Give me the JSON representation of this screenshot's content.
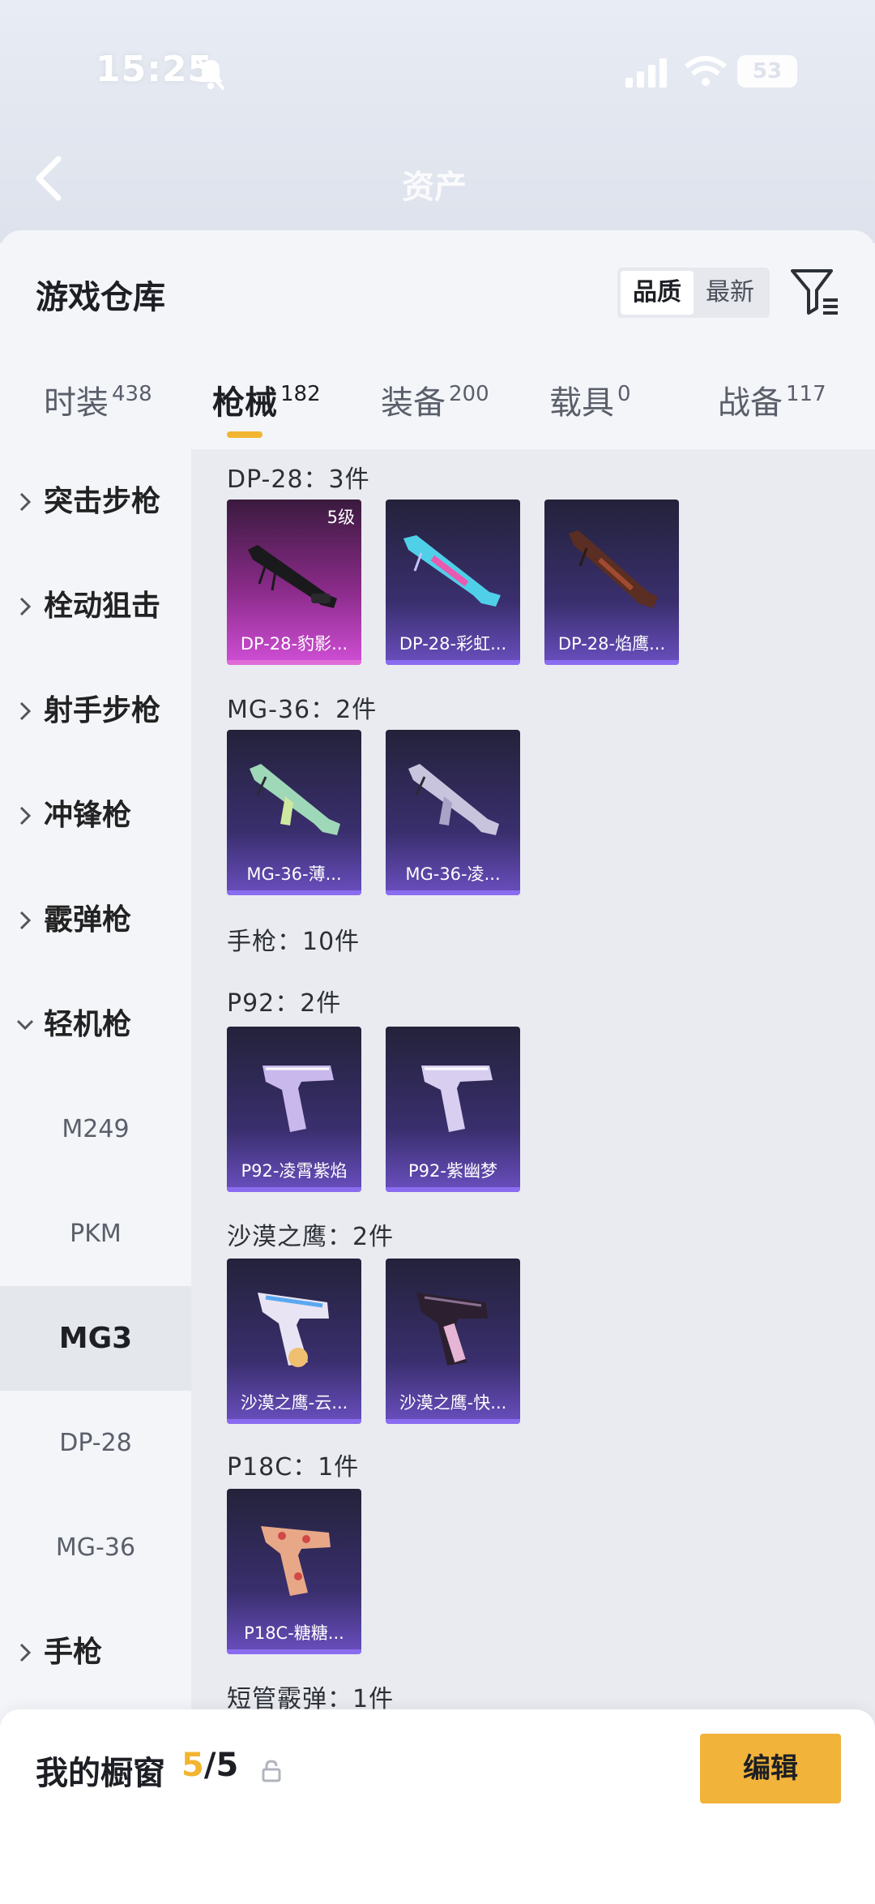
{
  "status_bar": {
    "time": "15:25",
    "battery": "53"
  },
  "header": {
    "title": "资产"
  },
  "page": {
    "title": "游戏仓库"
  },
  "sort": {
    "quality": "品质",
    "newest": "最新"
  },
  "tabs": [
    {
      "label": "时装",
      "count": "438"
    },
    {
      "label": "枪械",
      "count": "182"
    },
    {
      "label": "装备",
      "count": "200"
    },
    {
      "label": "载具",
      "count": "0"
    },
    {
      "label": "战备",
      "count": "117"
    }
  ],
  "sidebar": {
    "items": [
      {
        "label": "突击步枪"
      },
      {
        "label": "栓动狙击"
      },
      {
        "label": "射手步枪"
      },
      {
        "label": "冲锋枪"
      },
      {
        "label": "霰弹枪"
      },
      {
        "label": "轻机枪"
      },
      {
        "label": "M249"
      },
      {
        "label": "PKM"
      },
      {
        "label": "MG3"
      },
      {
        "label": "DP-28"
      },
      {
        "label": "MG-36"
      },
      {
        "label": "手枪"
      }
    ]
  },
  "groups": {
    "dp28": {
      "title": "DP-28：3件",
      "items": [
        "DP-28-豹影...",
        "DP-28-彩虹...",
        "DP-28-焰鹰..."
      ],
      "level": "5级"
    },
    "mg36": {
      "title": "MG-36：2件",
      "items": [
        "MG-36-薄...",
        "MG-36-凌..."
      ]
    },
    "pistol": {
      "title": "手枪：10件"
    },
    "p92": {
      "title": "P92：2件",
      "items": [
        "P92-凌霄紫焰",
        "P92-紫幽梦"
      ]
    },
    "deagle": {
      "title": "沙漠之鹰：2件",
      "items": [
        "沙漠之鹰-云...",
        "沙漠之鹰-快..."
      ]
    },
    "p18c": {
      "title": "P18C：1件",
      "items": [
        "P18C-糖糖..."
      ]
    },
    "sawed": {
      "title": "短管霰弹：1件"
    }
  },
  "showcase": {
    "label": "我的橱窗",
    "current": "5",
    "total": "/5",
    "edit": "编辑"
  },
  "colors": {
    "accent": "#f2b531",
    "card_purple": "#3a2f6e",
    "card_pink": "#8b2b8a"
  }
}
